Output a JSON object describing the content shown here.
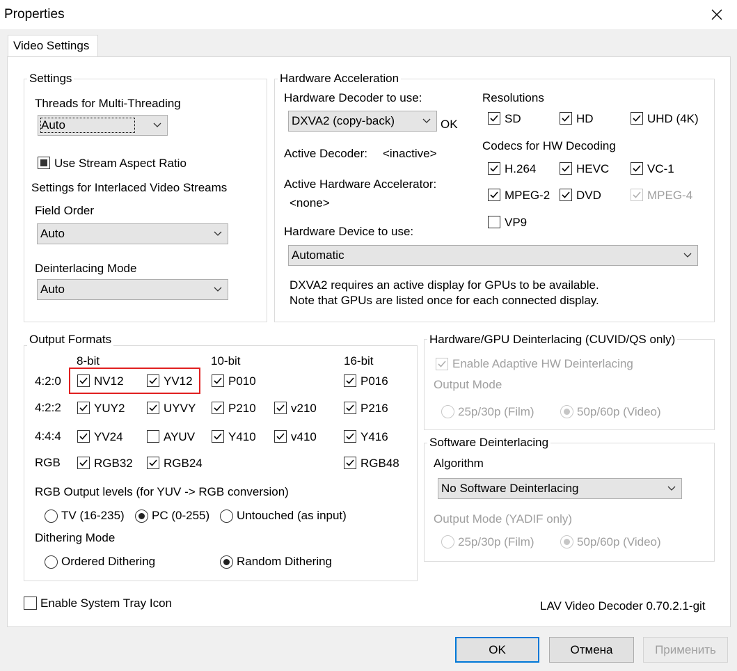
{
  "window": {
    "title": "Properties"
  },
  "tab": {
    "label": "Video Settings"
  },
  "settings": {
    "legend": "Settings",
    "threads_label": "Threads for Multi-Threading",
    "threads_value": "Auto",
    "aspect_label": "Use Stream Aspect Ratio",
    "interlaced_label": "Settings for Interlaced Video Streams",
    "field_order_label": "Field Order",
    "field_order_value": "Auto",
    "deint_mode_label": "Deinterlacing Mode",
    "deint_mode_value": "Auto"
  },
  "hwaccel": {
    "legend": "Hardware Acceleration",
    "decoder_label": "Hardware Decoder to use:",
    "decoder_value": "DXVA2 (copy-back)",
    "decoder_status": "OK",
    "active_decoder_label": "Active Decoder:",
    "active_decoder_value": "<inactive>",
    "active_accel_label": "Active Hardware Accelerator:",
    "active_accel_value": "<none>",
    "device_label": "Hardware Device to use:",
    "device_value": "Automatic",
    "note_line1": "DXVA2 requires an active display for GPUs to be available.",
    "note_line2": "Note that GPUs are listed once for each connected display.",
    "resolutions_label": "Resolutions",
    "res": {
      "sd": "SD",
      "hd": "HD",
      "uhd": "UHD (4K)"
    },
    "codecs_label": "Codecs for HW Decoding",
    "codecs": {
      "h264": "H.264",
      "hevc": "HEVC",
      "vc1": "VC-1",
      "mpeg2": "MPEG-2",
      "dvd": "DVD",
      "mpeg4": "MPEG-4",
      "vp9": "VP9"
    }
  },
  "output": {
    "legend": "Output Formats",
    "col_8bit": "8-bit",
    "col_10bit": "10-bit",
    "col_16bit": "16-bit",
    "row_420": "4:2:0",
    "row_422": "4:2:2",
    "row_444": "4:4:4",
    "row_rgb": "RGB",
    "f": {
      "nv12": "NV12",
      "yv12": "YV12",
      "p010": "P010",
      "p016": "P016",
      "yuy2": "YUY2",
      "uyvy": "UYVY",
      "p210": "P210",
      "v210": "v210",
      "p216": "P216",
      "yv24": "YV24",
      "ayuv": "AYUV",
      "y410": "Y410",
      "v410": "v410",
      "y416": "Y416",
      "rgb32": "RGB32",
      "rgb24": "RGB24",
      "rgb48": "RGB48"
    },
    "rgb_levels_label": "RGB Output levels (for YUV -> RGB conversion)",
    "level_tv": "TV (16-235)",
    "level_pc": "PC (0-255)",
    "level_untouched": "Untouched (as input)",
    "dither_label": "Dithering Mode",
    "dither_ordered": "Ordered Dithering",
    "dither_random": "Random Dithering"
  },
  "hwdeint": {
    "legend": "Hardware/GPU Deinterlacing (CUVID/QS only)",
    "adaptive_label": "Enable Adaptive HW Deinterlacing",
    "output_mode_label": "Output Mode",
    "film": "25p/30p (Film)",
    "video": "50p/60p (Video)"
  },
  "swdeint": {
    "legend": "Software Deinterlacing",
    "algorithm_label": "Algorithm",
    "algorithm_value": "No Software Deinterlacing",
    "output_mode_label": "Output Mode (YADIF only)",
    "film": "25p/30p (Film)",
    "video": "50p/60p (Video)"
  },
  "tray_label": "Enable System Tray Icon",
  "version": "LAV Video Decoder 0.70.2.1-git",
  "buttons": {
    "ok": "OK",
    "cancel": "Отмена",
    "apply": "Применить"
  },
  "colors": {
    "accent": "#0078d7",
    "highlight": "#e02020",
    "disabled_text": "#a0a0a0"
  }
}
